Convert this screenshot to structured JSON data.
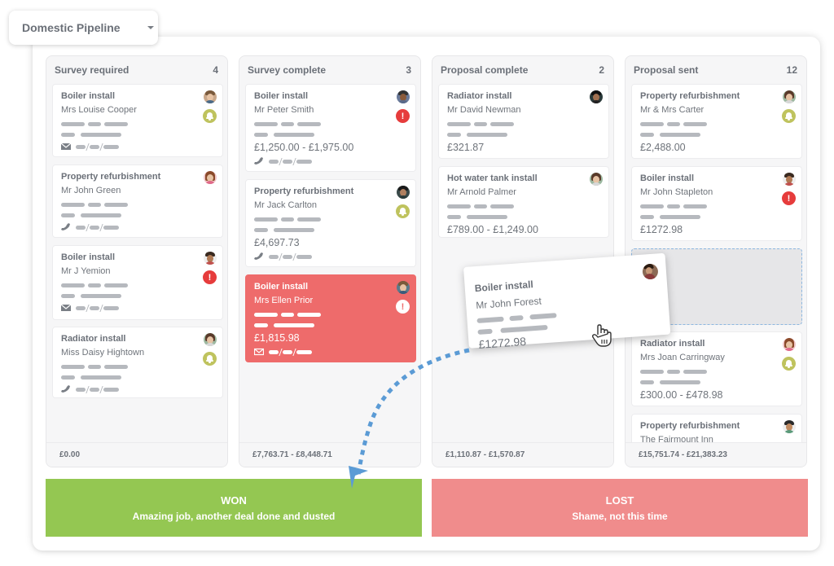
{
  "pipeline_selector": {
    "label": "Domestic Pipeline",
    "icon": "caret-down-icon"
  },
  "columns": [
    {
      "title": "Survey required",
      "count": "4",
      "total": "£0.00",
      "cards": [
        {
          "title": "Boiler install",
          "client": "Mrs Louise Cooper",
          "price": "",
          "contact": "email-icon",
          "status": "bell",
          "highlight": false
        },
        {
          "title": "Property refurbishment",
          "client": "Mr John Green",
          "price": "",
          "contact": "phone-icon",
          "status": "",
          "highlight": false
        },
        {
          "title": "Boiler install",
          "client": "Mr J Yemion",
          "price": "",
          "contact": "email-icon",
          "status": "alert",
          "highlight": false
        },
        {
          "title": "Radiator install",
          "client": "Miss Daisy Hightown",
          "price": "",
          "contact": "phone-icon",
          "status": "bell",
          "highlight": false
        }
      ]
    },
    {
      "title": "Survey complete",
      "count": "3",
      "total": "£7,763.71 - £8,448.71",
      "cards": [
        {
          "title": "Boiler install",
          "client": "Mr Peter Smith",
          "price": "£1,250.00 - £1,975.00",
          "contact": "phone-icon",
          "status": "alert",
          "highlight": false
        },
        {
          "title": "Property refurbishment",
          "client": "Mr Jack Carlton",
          "price": "£4,697.73",
          "contact": "phone-icon",
          "status": "bell",
          "highlight": false
        },
        {
          "title": "Boiler install",
          "client": "Mrs Ellen Prior",
          "price": "£1,815.98",
          "contact": "email-icon",
          "status": "alert",
          "highlight": true
        }
      ]
    },
    {
      "title": "Proposal complete",
      "count": "2",
      "total": "£1,110.87 - £1,570.87",
      "cards": [
        {
          "title": "Radiator install",
          "client": "Mr David Newman",
          "price": "£321.87",
          "contact": "",
          "status": "",
          "highlight": false
        },
        {
          "title": "Hot water tank install",
          "client": "Mr Arnold Palmer",
          "price": "£789.00 - £1,249.00",
          "contact": "",
          "status": "",
          "highlight": false
        }
      ]
    },
    {
      "title": "Proposal sent",
      "count": "12",
      "total": "£15,751.74 - £21,383.23",
      "cards": [
        {
          "title": "Property refurbishment",
          "client": "Mr & Mrs Carter",
          "price": "£2,488.00",
          "contact": "",
          "status": "bell",
          "highlight": false
        },
        {
          "title": "Boiler install",
          "client": "Mr John Stapleton",
          "price": "£1272.98",
          "contact": "",
          "status": "alert",
          "highlight": false
        },
        {
          "title": "Radiator install",
          "client": "Mrs Joan Carringway",
          "price": "£300.00 - £478.98",
          "contact": "",
          "status": "bell",
          "highlight": false
        },
        {
          "title": "Property refurbishment",
          "client": "The Fairmount Inn",
          "price": "",
          "contact": "",
          "status": "",
          "highlight": false
        }
      ]
    }
  ],
  "dragging_card": {
    "title": "Boiler install",
    "client": "Mr John Forest",
    "price": "£1272.98"
  },
  "drop_zones": {
    "won": {
      "title": "WON",
      "subtitle": "Amazing job, another deal done and dusted",
      "color": "#94c752"
    },
    "lost": {
      "title": "LOST",
      "subtitle": "Shame, not this time",
      "color": "#f08c8c"
    }
  },
  "colors": {
    "alert": "#e63c3c",
    "bell": "#bfc35e",
    "highlight_card": "#ee6b6b",
    "drag_path": "#5b9bd5"
  }
}
